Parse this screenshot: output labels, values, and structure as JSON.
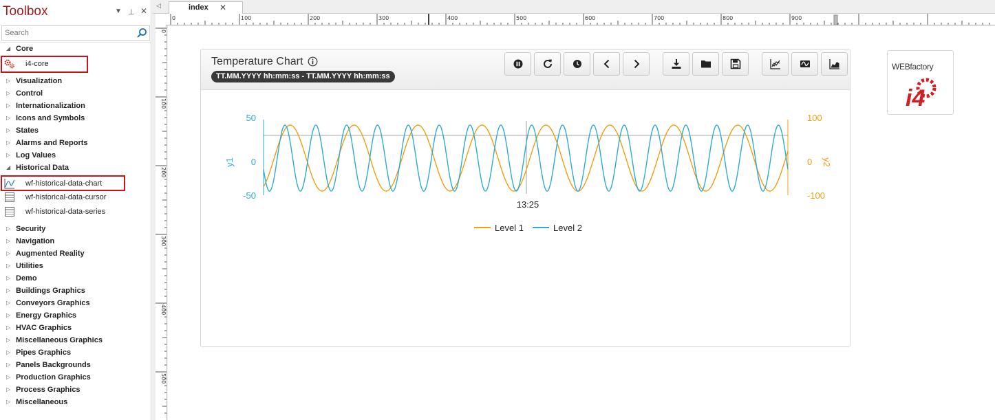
{
  "toolbox": {
    "title": "Toolbox",
    "search_placeholder": "Search",
    "core_category": "Core",
    "core_item": "i4-core",
    "categories_a": [
      "Visualization",
      "Control",
      "Internationalization",
      "Icons and Symbols",
      "States",
      "Alarms and Reports",
      "Log Values"
    ],
    "historical_category": "Historical Data",
    "historical_items": [
      "wf-historical-data-chart",
      "wf-historical-data-cursor",
      "wf-historical-data-series"
    ],
    "categories_b": [
      "Security",
      "Navigation",
      "Augmented Reality",
      "Utilities",
      "Demo",
      "Buildings Graphics",
      "Conveyors Graphics",
      "Energy Graphics",
      "HVAC Graphics",
      "Miscellaneous Graphics",
      "Pipes Graphics",
      "Panels Backgrounds",
      "Production Graphics",
      "Process Graphics",
      "Miscellaneous"
    ]
  },
  "tab": {
    "label": "index",
    "close": "✕"
  },
  "ruler": {
    "top_labels": [
      "0",
      "100",
      "200",
      "300",
      "400",
      "500",
      "600",
      "700",
      "800",
      "900"
    ],
    "left_labels": [
      "0",
      "100",
      "200",
      "300",
      "400",
      "500"
    ]
  },
  "chart_widget": {
    "title": "Temperature Chart",
    "time_range": "TT.MM.YYYY hh:mm:ss - TT.MM.YYYY hh:mm:ss",
    "toolbar_buttons": [
      "pause-icon",
      "refresh-icon",
      "clock-icon",
      "chevron-left-icon",
      "chevron-right-icon",
      "download-icon",
      "folder-icon",
      "save-icon",
      "line-chart-icon",
      "wave-icon",
      "area-chart-icon"
    ]
  },
  "chart_data": {
    "type": "line",
    "x_tick_label": "13:25",
    "y1": {
      "label": "y1",
      "ticks": [
        50,
        0,
        -50
      ],
      "range": [
        -50,
        50
      ],
      "color": "#2eaad4"
    },
    "y2": {
      "label": "y2",
      "ticks": [
        100,
        0,
        -100
      ],
      "range": [
        -100,
        100
      ],
      "color": "#f39c12"
    },
    "series": [
      {
        "name": "Level 1",
        "axis": "y2",
        "color": "#f39c12",
        "amplitude": 80,
        "cycles": 8.2,
        "phase_deg": 300
      },
      {
        "name": "Level 2",
        "axis": "y1",
        "color": "#2eaad4",
        "amplitude": 40,
        "cycles": 17,
        "phase_deg": 200
      }
    ],
    "legend_placement": "bottom-center",
    "grid": false
  },
  "logo": {
    "text": "WEBfactory",
    "mark": "i4"
  }
}
